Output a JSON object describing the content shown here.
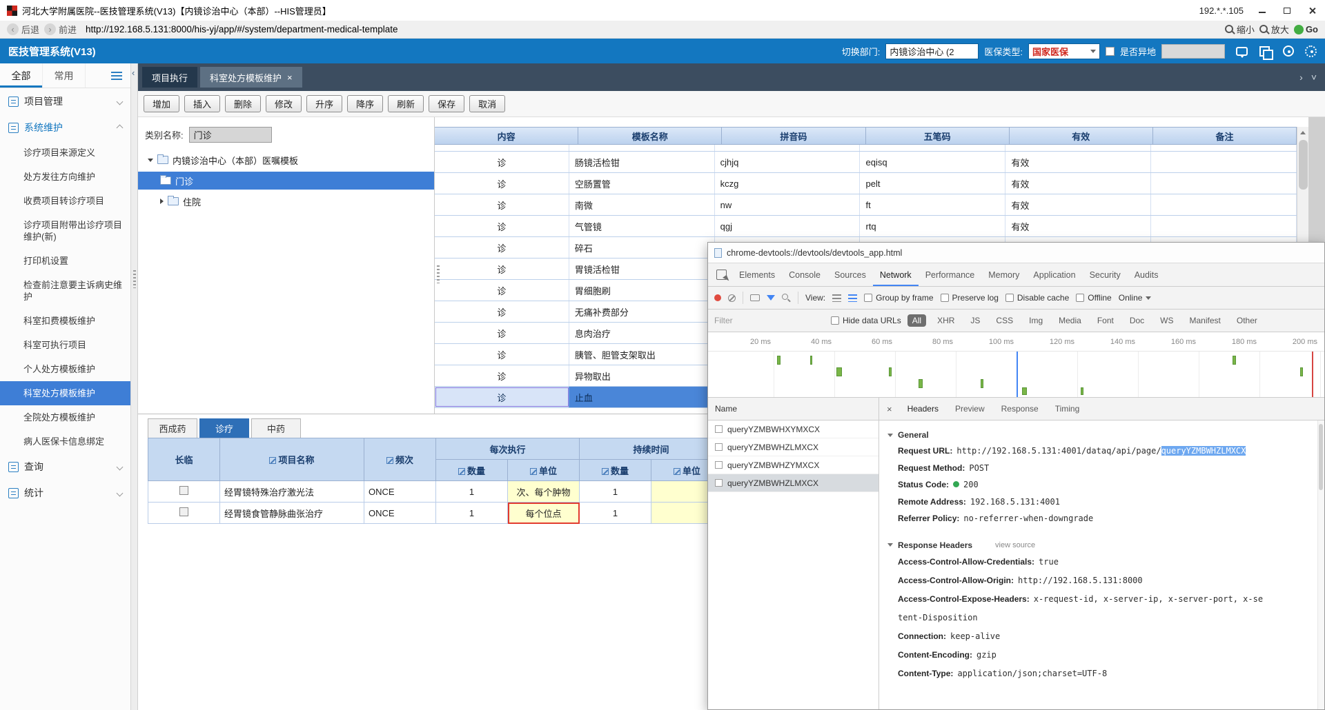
{
  "titlebar": {
    "title": "河北大学附属医院--医技管理系统(V13)【内镜诊治中心（本部）--HIS管理员】",
    "ip": "192.*.*.105"
  },
  "addressbar": {
    "back": "后退",
    "forward": "前进",
    "url": "http://192.168.5.131:8000/his-yj/app/#/system/department-medical-template",
    "zoom_out": "缩小",
    "zoom_in": "放大",
    "go": "Go"
  },
  "appbar": {
    "title": "医技管理系统(V13)",
    "dept_label": "切换部门:",
    "dept_value": "内镜诊治中心 (2",
    "insurance_label": "医保类型:",
    "insurance_value": "国家医保",
    "offsite_label": "是否异地"
  },
  "sidebar": {
    "tabs": [
      {
        "label": "全部"
      },
      {
        "label": "常用"
      }
    ],
    "groups": [
      {
        "label": "项目管理"
      },
      {
        "label": "系统维护"
      }
    ],
    "items": [
      {
        "label": "诊疗项目来源定义"
      },
      {
        "label": "处方发往方向维护"
      },
      {
        "label": "收费项目转诊疗项目"
      },
      {
        "label": "诊疗项目附带出诊疗项目维护(新)"
      },
      {
        "label": "打印机设置"
      },
      {
        "label": "检查前注意要主诉病史维护"
      },
      {
        "label": "科室扣费模板维护"
      },
      {
        "label": "科室可执行项目"
      },
      {
        "label": "个人处方模板维护"
      },
      {
        "label": "科室处方模板维护"
      },
      {
        "label": "全院处方模板维护"
      },
      {
        "label": "病人医保卡信息绑定"
      }
    ],
    "footer_groups": [
      {
        "label": "查询"
      },
      {
        "label": "统计"
      }
    ]
  },
  "main": {
    "doc_tabs": [
      {
        "label": "项目执行"
      },
      {
        "label": "科室处方模板维护",
        "close": "×"
      }
    ],
    "toolbar": [
      {
        "label": "增加"
      },
      {
        "label": "插入"
      },
      {
        "label": "删除"
      },
      {
        "label": "修改"
      },
      {
        "label": "升序"
      },
      {
        "label": "降序"
      },
      {
        "label": "刷新"
      },
      {
        "label": "保存"
      },
      {
        "label": "取消"
      }
    ],
    "category": {
      "label": "类别名称:",
      "value": "门诊"
    },
    "tree": {
      "root": "内镜诊治中心（本部）医嘱模板",
      "child1": "门诊",
      "child2": "住院"
    },
    "grid": {
      "headers": [
        {
          "label": "内容"
        },
        {
          "label": "模板名称"
        },
        {
          "label": "拼音码"
        },
        {
          "label": "五笔码"
        },
        {
          "label": "有效"
        },
        {
          "label": "备注"
        }
      ],
      "rows": [
        {
          "c": "",
          "name": "",
          "py": "",
          "wb": "",
          "valid": "",
          "note": ""
        },
        {
          "c": "诊",
          "name": "肠镜活检钳",
          "py": "cjhjq",
          "wb": "eqisq",
          "valid": "有效",
          "note": ""
        },
        {
          "c": "诊",
          "name": "空肠置管",
          "py": "kczg",
          "wb": "pelt",
          "valid": "有效",
          "note": ""
        },
        {
          "c": "诊",
          "name": "南微",
          "py": "nw",
          "wb": "ft",
          "valid": "有效",
          "note": ""
        },
        {
          "c": "诊",
          "name": "气管镜",
          "py": "qgj",
          "wb": "rtq",
          "valid": "有效",
          "note": ""
        },
        {
          "c": "诊",
          "name": "碎石",
          "py": "",
          "wb": "",
          "valid": "",
          "note": ""
        },
        {
          "c": "诊",
          "name": "胃镜活检钳",
          "py": "",
          "wb": "",
          "valid": "",
          "note": ""
        },
        {
          "c": "诊",
          "name": "胃细胞刷",
          "py": "",
          "wb": "",
          "valid": "",
          "note": ""
        },
        {
          "c": "诊",
          "name": "无痛补费部分",
          "py": "",
          "wb": "",
          "valid": "",
          "note": ""
        },
        {
          "c": "诊",
          "name": "息肉治疗",
          "py": "",
          "wb": "",
          "valid": "",
          "note": ""
        },
        {
          "c": "诊",
          "name": "胰管、胆管支架取出",
          "py": "",
          "wb": "",
          "valid": "",
          "note": ""
        },
        {
          "c": "诊",
          "name": "异物取出",
          "py": "",
          "wb": "",
          "valid": "",
          "note": ""
        },
        {
          "c": "诊",
          "name": "止血",
          "py": "",
          "wb": "",
          "valid": "",
          "note": ""
        }
      ]
    },
    "rx": {
      "tabs": [
        {
          "label": "西成药"
        },
        {
          "label": "诊疗"
        },
        {
          "label": "中药"
        }
      ],
      "headers": {
        "cl": "长临",
        "name": "项目名称",
        "freq": "频次",
        "per": "每次执行",
        "dur": "持续时间",
        "qty": "数量",
        "unit": "单位"
      },
      "rows": [
        {
          "name": "经胃镜特殊治疗激光法",
          "freq": "ONCE",
          "qty": "1",
          "unit": "次、每个肿物",
          "dqty": "1",
          "dunit": ""
        },
        {
          "name": "经胃镜食管静脉曲张治疗",
          "freq": "ONCE",
          "qty": "1",
          "unit": "每个位点",
          "dqty": "1",
          "dunit": ""
        }
      ]
    }
  },
  "devtools": {
    "title": "chrome-devtools://devtools/devtools_app.html",
    "tabs": [
      {
        "label": "Elements"
      },
      {
        "label": "Console"
      },
      {
        "label": "Sources"
      },
      {
        "label": "Network"
      },
      {
        "label": "Performance"
      },
      {
        "label": "Memory"
      },
      {
        "label": "Application"
      },
      {
        "label": "Security"
      },
      {
        "label": "Audits"
      }
    ],
    "toolbar": {
      "view": "View:",
      "group_by_frame": "Group by frame",
      "preserve_log": "Preserve log",
      "disable_cache": "Disable cache",
      "offline": "Offline",
      "online": "Online"
    },
    "filter": {
      "placeholder": "Filter",
      "hide_data_urls": "Hide data URLs",
      "pills": [
        {
          "label": "All"
        },
        {
          "label": "XHR"
        },
        {
          "label": "JS"
        },
        {
          "label": "CSS"
        },
        {
          "label": "Img"
        },
        {
          "label": "Media"
        },
        {
          "label": "Font"
        },
        {
          "label": "Doc"
        },
        {
          "label": "WS"
        },
        {
          "label": "Manifest"
        },
        {
          "label": "Other"
        }
      ]
    },
    "timeline": [
      "20 ms",
      "40 ms",
      "60 ms",
      "80 ms",
      "100 ms",
      "120 ms",
      "140 ms",
      "160 ms",
      "180 ms",
      "200 ms"
    ],
    "name_header": "Name",
    "requests": [
      {
        "name": "queryYZMBWHXYMXCX"
      },
      {
        "name": "queryYZMBWHZLMXCX"
      },
      {
        "name": "queryYZMBWHZYMXCX"
      },
      {
        "name": "queryYZMBWHZLMXCX"
      }
    ],
    "close": "×",
    "detail_tabs": [
      {
        "label": "Headers"
      },
      {
        "label": "Preview"
      },
      {
        "label": "Response"
      },
      {
        "label": "Timing"
      }
    ],
    "general": {
      "title": "General",
      "url_label": "Request URL:",
      "url_prefix": "http://192.168.5.131:4001/dataq/api/page/",
      "url_sel": "queryYZMBWHZLMXCX",
      "method_label": "Request Method:",
      "method": "POST",
      "status_label": "Status Code:",
      "status": "200",
      "remote_label": "Remote Address:",
      "remote": "192.168.5.131:4001",
      "referrer_label": "Referrer Policy:",
      "referrer": "no-referrer-when-downgrade"
    },
    "response_headers": {
      "title": "Response Headers",
      "view_source": "view source",
      "entries": [
        {
          "name": "Access-Control-Allow-Credentials:",
          "value": "true"
        },
        {
          "name": "Access-Control-Allow-Origin:",
          "value": "http://192.168.5.131:8000"
        },
        {
          "name": "Access-Control-Expose-Headers:",
          "value": "x-request-id, x-server-ip, x-server-port, x-se",
          "value2": "tent-Disposition"
        },
        {
          "name": "Connection:",
          "value": "keep-alive"
        },
        {
          "name": "Content-Encoding:",
          "value": "gzip"
        },
        {
          "name": "Content-Type:",
          "value": "application/json;charset=UTF-8"
        }
      ]
    }
  }
}
